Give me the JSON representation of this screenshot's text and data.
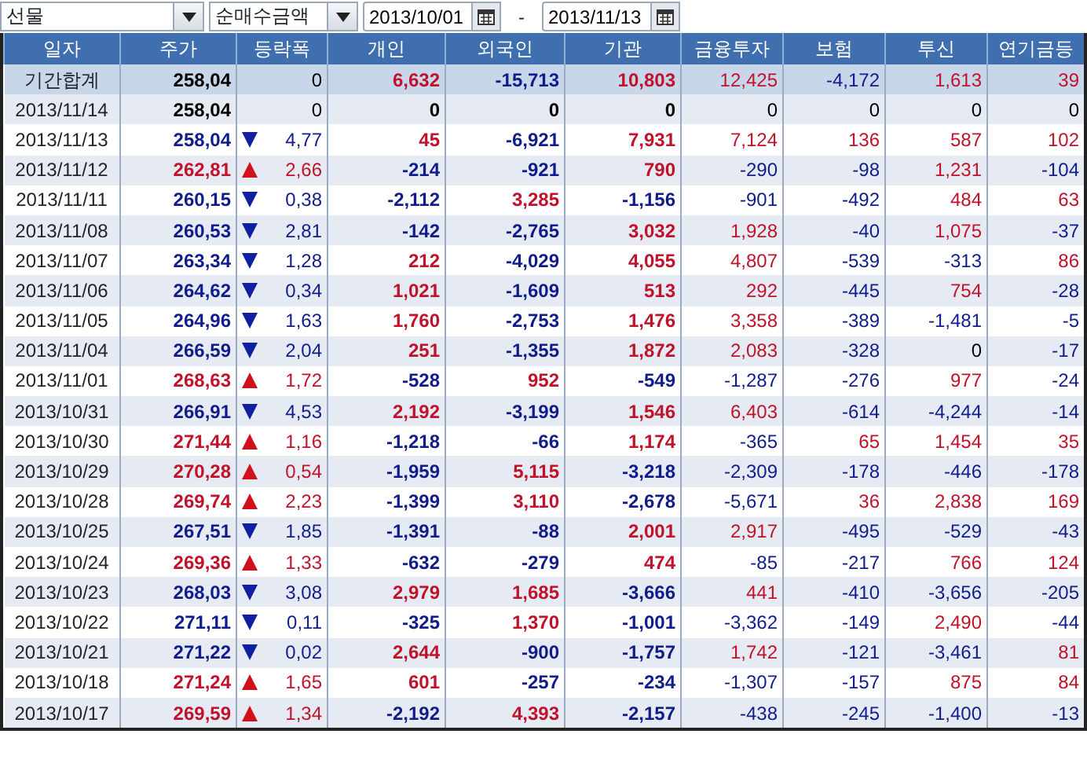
{
  "toolbar": {
    "market_select": "선물",
    "measure_select": "순매수금액",
    "start_date": "2013/10/01",
    "date_separator": "-",
    "end_date": "2013/11/13"
  },
  "table": {
    "columns": [
      "일자",
      "주가",
      "등락폭",
      "개인",
      "외국인",
      "기관",
      "금융투자",
      "보험",
      "투신",
      "연기금등"
    ],
    "rows": [
      {
        "summary": true,
        "kind": "unchanged",
        "cells": [
          "기간합계",
          "258,04",
          "0",
          "6,632",
          "-15,713",
          "10,803",
          "12,425",
          "-4,172",
          "1,613",
          "39"
        ]
      },
      {
        "summary": false,
        "kind": "unchanged",
        "cells": [
          "2013/11/14",
          "258,04",
          "0",
          "0",
          "0",
          "0",
          "0",
          "0",
          "0",
          "0"
        ]
      },
      {
        "summary": false,
        "kind": "falling",
        "cells": [
          "2013/11/13",
          "258,04",
          "4,77",
          "45",
          "-6,921",
          "7,931",
          "7,124",
          "136",
          "587",
          "102"
        ]
      },
      {
        "summary": false,
        "kind": "rising",
        "cells": [
          "2013/11/12",
          "262,81",
          "2,66",
          "-214",
          "-921",
          "790",
          "-290",
          "-98",
          "1,231",
          "-104"
        ]
      },
      {
        "summary": false,
        "kind": "falling",
        "cells": [
          "2013/11/11",
          "260,15",
          "0,38",
          "-2,112",
          "3,285",
          "-1,156",
          "-901",
          "-492",
          "484",
          "63"
        ]
      },
      {
        "summary": false,
        "kind": "falling",
        "cells": [
          "2013/11/08",
          "260,53",
          "2,81",
          "-142",
          "-2,765",
          "3,032",
          "1,928",
          "-40",
          "1,075",
          "-37"
        ]
      },
      {
        "summary": false,
        "kind": "falling",
        "cells": [
          "2013/11/07",
          "263,34",
          "1,28",
          "212",
          "-4,029",
          "4,055",
          "4,807",
          "-539",
          "-313",
          "86"
        ]
      },
      {
        "summary": false,
        "kind": "falling",
        "cells": [
          "2013/11/06",
          "264,62",
          "0,34",
          "1,021",
          "-1,609",
          "513",
          "292",
          "-445",
          "754",
          "-28"
        ]
      },
      {
        "summary": false,
        "kind": "falling",
        "cells": [
          "2013/11/05",
          "264,96",
          "1,63",
          "1,760",
          "-2,753",
          "1,476",
          "3,358",
          "-389",
          "-1,481",
          "-5"
        ]
      },
      {
        "summary": false,
        "kind": "falling",
        "cells": [
          "2013/11/04",
          "266,59",
          "2,04",
          "251",
          "-1,355",
          "1,872",
          "2,083",
          "-328",
          "0",
          "-17"
        ]
      },
      {
        "summary": false,
        "kind": "rising",
        "cells": [
          "2013/11/01",
          "268,63",
          "1,72",
          "-528",
          "952",
          "-549",
          "-1,287",
          "-276",
          "977",
          "-24"
        ]
      },
      {
        "summary": false,
        "kind": "falling",
        "cells": [
          "2013/10/31",
          "266,91",
          "4,53",
          "2,192",
          "-3,199",
          "1,546",
          "6,403",
          "-614",
          "-4,244",
          "-14"
        ]
      },
      {
        "summary": false,
        "kind": "rising",
        "cells": [
          "2013/10/30",
          "271,44",
          "1,16",
          "-1,218",
          "-66",
          "1,174",
          "-365",
          "65",
          "1,454",
          "35"
        ]
      },
      {
        "summary": false,
        "kind": "rising",
        "cells": [
          "2013/10/29",
          "270,28",
          "0,54",
          "-1,959",
          "5,115",
          "-3,218",
          "-2,309",
          "-178",
          "-446",
          "-178"
        ]
      },
      {
        "summary": false,
        "kind": "rising",
        "cells": [
          "2013/10/28",
          "269,74",
          "2,23",
          "-1,399",
          "3,110",
          "-2,678",
          "-5,671",
          "36",
          "2,838",
          "169"
        ]
      },
      {
        "summary": false,
        "kind": "falling",
        "cells": [
          "2013/10/25",
          "267,51",
          "1,85",
          "-1,391",
          "-88",
          "2,001",
          "2,917",
          "-495",
          "-529",
          "-43"
        ]
      },
      {
        "summary": false,
        "kind": "rising",
        "cells": [
          "2013/10/24",
          "269,36",
          "1,33",
          "-632",
          "-279",
          "474",
          "-85",
          "-217",
          "766",
          "124"
        ]
      },
      {
        "summary": false,
        "kind": "falling",
        "cells": [
          "2013/10/23",
          "268,03",
          "3,08",
          "2,979",
          "1,685",
          "-3,666",
          "441",
          "-410",
          "-3,656",
          "-205"
        ]
      },
      {
        "summary": false,
        "kind": "falling",
        "cells": [
          "2013/10/22",
          "271,11",
          "0,11",
          "-325",
          "1,370",
          "-1,001",
          "-3,362",
          "-149",
          "2,490",
          "-44"
        ]
      },
      {
        "summary": false,
        "kind": "falling",
        "cells": [
          "2013/10/21",
          "271,22",
          "0,02",
          "2,644",
          "-900",
          "-1,757",
          "1,742",
          "-121",
          "-3,461",
          "81"
        ]
      },
      {
        "summary": false,
        "kind": "rising",
        "cells": [
          "2013/10/18",
          "271,24",
          "1,65",
          "601",
          "-257",
          "-234",
          "-1,307",
          "-157",
          "875",
          "84"
        ]
      },
      {
        "summary": false,
        "kind": "rising",
        "cells": [
          "2013/10/17",
          "269,59",
          "1,34",
          "-2,192",
          "4,393",
          "-2,157",
          "-438",
          "-245",
          "-1,400",
          "-13"
        ]
      }
    ]
  }
}
